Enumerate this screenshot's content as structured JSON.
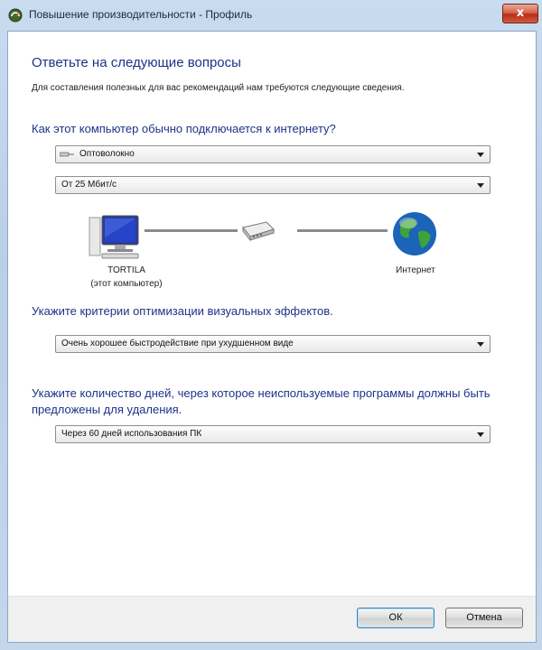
{
  "window": {
    "title": "Повышение производительности - Профиль",
    "close_label": "x"
  },
  "header": {
    "heading": "Ответьте на следующие вопросы",
    "subtext": "Для составления полезных для вас рекомендаций нам требуются следующие сведения."
  },
  "connection": {
    "question": "Как этот компьютер обычно подключается к интернету?",
    "type_select": {
      "value": "Оптоволокно",
      "icon": "cable-icon"
    },
    "speed_select": {
      "value": "От 25 Мбит/с"
    },
    "diagram": {
      "computer_label": "TORTILA",
      "computer_sublabel": "(этот компьютер)",
      "internet_label": "Интернет"
    }
  },
  "visual_effects": {
    "question": "Укажите критерии оптимизации визуальных эффектов.",
    "select": {
      "value": "Очень хорошее быстродействие при ухудшенном виде"
    }
  },
  "unused_programs": {
    "question": "Укажите количество дней, через которое неиспользуемые программы должны быть предложены для удаления.",
    "select": {
      "value": "Через 60 дней использования ПК"
    }
  },
  "buttons": {
    "ok": "ОК",
    "cancel": "Отмена"
  }
}
